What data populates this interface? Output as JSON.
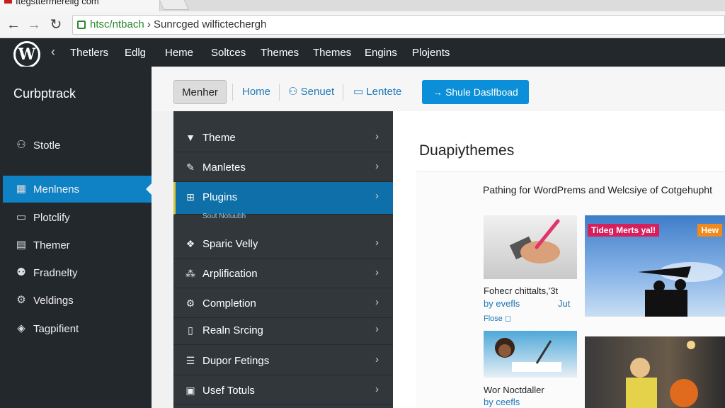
{
  "browser": {
    "tab_title": "Itegsttermerelig com",
    "back": "←",
    "forward": "→",
    "reload": "↻",
    "url_scheme": "htsc/ntbach",
    "url_rest": "› Sunrcged wilfictechergh"
  },
  "topbar": {
    "logo": "W",
    "back": "‹",
    "items": [
      "Thetlers",
      "Edlg",
      "Heme",
      "Soltces",
      "Themes",
      "Themes",
      "Engins",
      "Plojents"
    ]
  },
  "sidebar": {
    "site_name": "Curbptrack",
    "items": [
      {
        "label": "Stotle",
        "icon": "user-icon"
      },
      {
        "label": "Menlnens",
        "icon": "grid-icon",
        "active": true
      },
      {
        "label": "Plotclify",
        "icon": "comment-icon"
      },
      {
        "label": "Themer",
        "icon": "layout-icon"
      },
      {
        "label": "Fradnelty",
        "icon": "people-icon"
      },
      {
        "label": "Veldings",
        "icon": "gear-icon"
      },
      {
        "label": "Tagpifient",
        "icon": "tag-icon"
      }
    ]
  },
  "toolbar": {
    "member": "Menher",
    "home": "Home",
    "senuet": "Senuet",
    "lentete": "Lentete",
    "primary": "Shule Daslfboad"
  },
  "dropdown": {
    "items": [
      {
        "label": "Theme",
        "icon": "brush-icon"
      },
      {
        "label": "Manletes",
        "icon": "wrench-icon"
      },
      {
        "label": "Plugins",
        "icon": "plugin-icon",
        "active": true
      },
      {
        "label": "Sparic Velly",
        "icon": "palette-icon"
      },
      {
        "label": "Arplification",
        "icon": "network-icon"
      },
      {
        "label": "Completion",
        "icon": "settings-icon"
      },
      {
        "label": "Realn Srcing",
        "icon": "document-icon"
      },
      {
        "label": "Dupor Fetings",
        "icon": "list-icon"
      },
      {
        "label": "Usef Totuls",
        "icon": "table-icon"
      }
    ],
    "submenu_hint": "Sout Notuubh"
  },
  "content": {
    "title": "Duapiythemes",
    "subtitle": "Pathing for WordPrems and Welcsiye of Cotgehupht",
    "cards": [
      {
        "title": "Fohecr chittalts,'3t",
        "meta_left": "by evefls",
        "meta_right": "Jut",
        "link": "Flose ◻"
      },
      {
        "badge_left": "Tideg Merts yal!",
        "badge_right": "Hew"
      },
      {
        "title": "Wor Noctdaller",
        "meta_left": "by ceefls"
      },
      {}
    ]
  },
  "colors": {
    "admin_bar": "#23282d",
    "accent_blue": "#0f81c5",
    "primary_button": "#0a8fd8",
    "dropdown_bg": "#32373c"
  }
}
